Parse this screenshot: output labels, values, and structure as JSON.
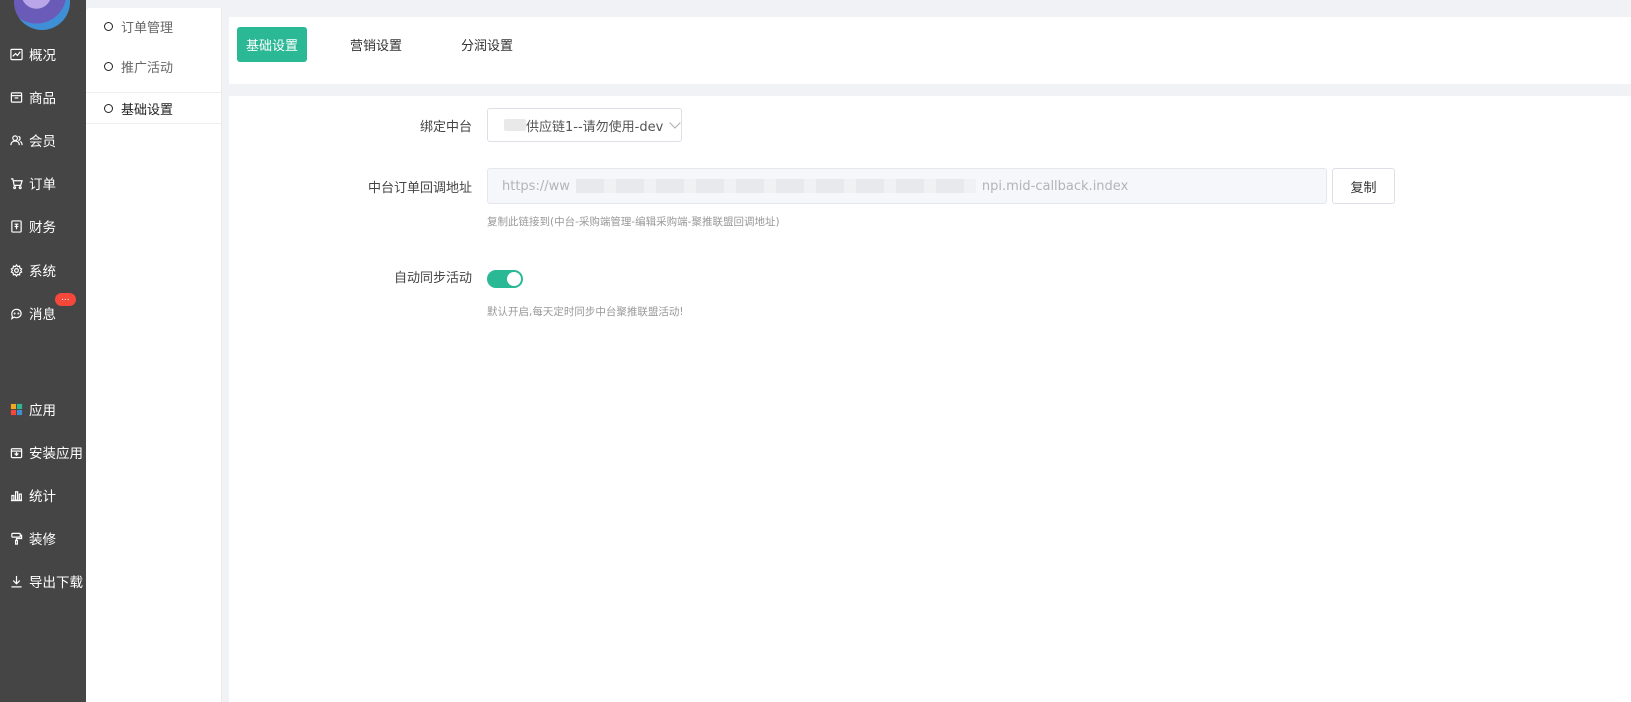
{
  "nav": {
    "items": [
      {
        "label": "概况",
        "icon": "chart-line-icon"
      },
      {
        "label": "商品",
        "icon": "box-icon"
      },
      {
        "label": "会员",
        "icon": "users-icon"
      },
      {
        "label": "订单",
        "icon": "cart-icon"
      },
      {
        "label": "财务",
        "icon": "ledger-icon"
      },
      {
        "label": "系统",
        "icon": "gear-icon"
      },
      {
        "label": "消息",
        "icon": "chat-icon",
        "badge": "..."
      },
      {
        "label": "应用",
        "icon": "apps-grid-icon"
      },
      {
        "label": "安装应用",
        "icon": "install-icon"
      },
      {
        "label": "统计",
        "icon": "bar-chart-icon"
      },
      {
        "label": "装修",
        "icon": "paint-roller-icon"
      },
      {
        "label": "导出下载",
        "icon": "download-icon"
      }
    ]
  },
  "subnav": {
    "items": [
      {
        "label": "订单管理"
      },
      {
        "label": "推广活动"
      },
      {
        "label": "基础设置",
        "active": true
      }
    ]
  },
  "tabs": [
    {
      "label": "基础设置",
      "active": true
    },
    {
      "label": "营销设置"
    },
    {
      "label": "分润设置"
    }
  ],
  "form": {
    "bind_label": "绑定中台",
    "bind_value": "供应链1--请勿使用-dev",
    "callback_label": "中台订单回调地址",
    "callback_prefix": "https://ww",
    "callback_suffix": "npi.mid-callback.index",
    "copy_label": "复制",
    "callback_hint": "复制此链接到(中台-采购端管理-编辑采购端-聚推联盟回调地址)",
    "sync_label": "自动同步活动",
    "sync_on": true,
    "sync_hint": "默认开启,每天定时同步中台聚推联盟活动!"
  },
  "colors": {
    "accent": "#2bb894",
    "rail": "#454545",
    "badge": "#f5483b"
  }
}
